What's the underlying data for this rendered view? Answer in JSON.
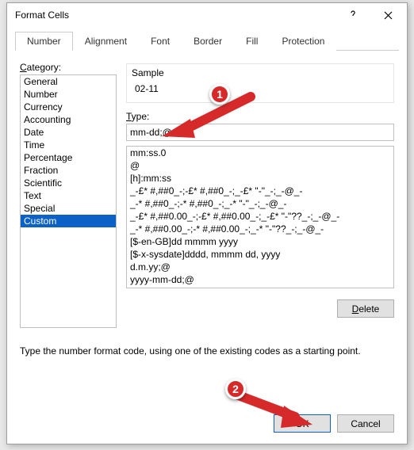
{
  "title": "Format Cells",
  "tabs": [
    "Number",
    "Alignment",
    "Font",
    "Border",
    "Fill",
    "Protection"
  ],
  "active_tab": 0,
  "category_label": "Category:",
  "categories": [
    "General",
    "Number",
    "Currency",
    "Accounting",
    "Date",
    "Time",
    "Percentage",
    "Fraction",
    "Scientific",
    "Text",
    "Special",
    "Custom"
  ],
  "selected_category_index": 11,
  "sample_label": "Sample",
  "sample_value": "02-11",
  "type_label": "Type:",
  "type_value": "mm-dd;@",
  "format_list": [
    "mm:ss.0",
    "@",
    "[h]:mm:ss",
    "_-£* #,##0_-;-£* #,##0_-;_-£* \"-\"_-;_-@_-",
    "_-* #,##0_-;-* #,##0_-;_-* \"-\"_-;_-@_-",
    "_-£* #,##0.00_-;-£* #,##0.00_-;_-£* \"-\"??_-;_-@_-",
    "_-* #,##0.00_-;-* #,##0.00_-;_-* \"-\"??_-;_-@_-",
    "[$-en-GB]dd mmmm yyyy",
    "[$-x-sysdate]dddd, mmmm dd, yyyy",
    "d.m.yy;@",
    "yyyy-mm-dd;@"
  ],
  "delete_label": "Delete",
  "hint": "Type the number format code, using one of the existing codes as a starting point.",
  "ok_label": "OK",
  "cancel_label": "Cancel",
  "annotations": {
    "badge1": "1",
    "badge2": "2"
  }
}
